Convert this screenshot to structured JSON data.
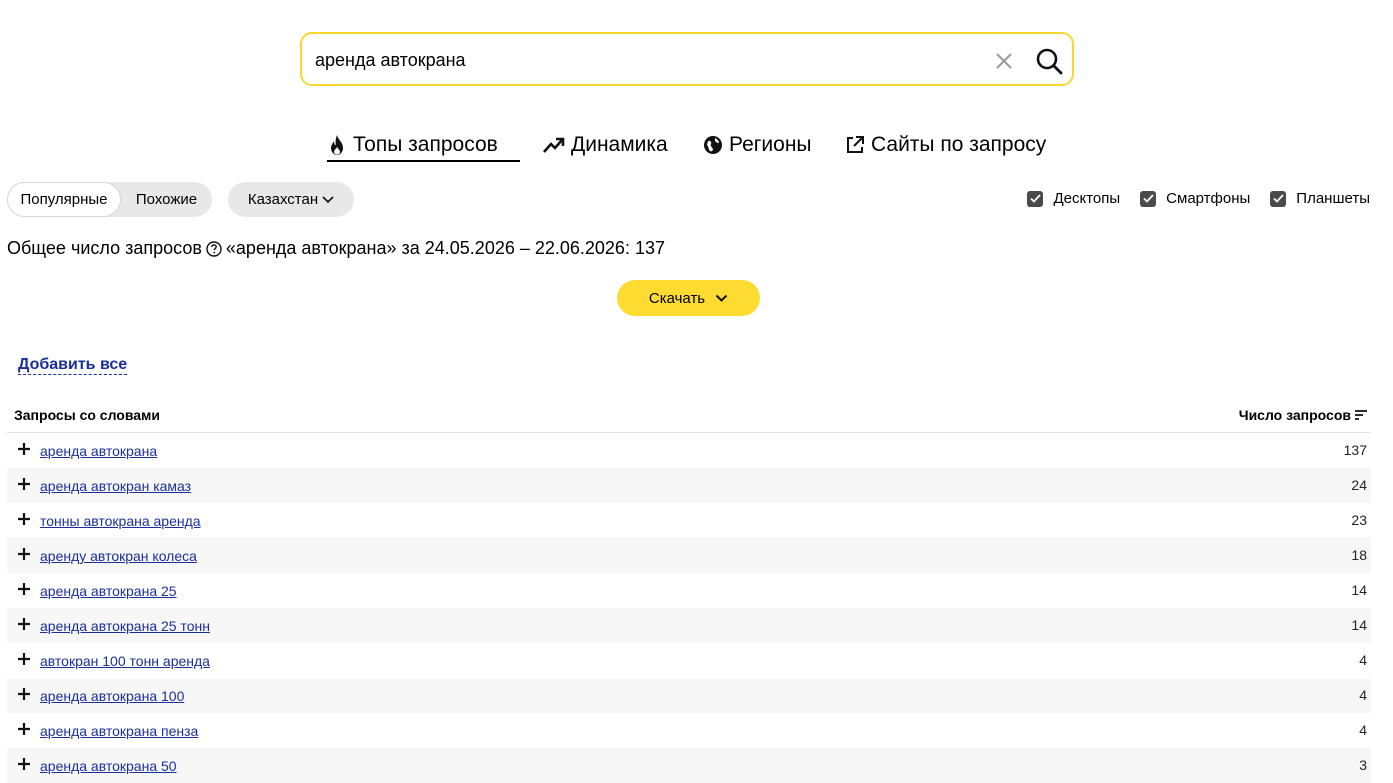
{
  "search": {
    "value": "аренда автокрана"
  },
  "tabs": [
    {
      "label": "Топы запросов",
      "icon": "fire-icon",
      "active": true
    },
    {
      "label": "Динамика",
      "icon": "trend-icon",
      "active": false
    },
    {
      "label": "Регионы",
      "icon": "globe-icon",
      "active": false
    },
    {
      "label": "Сайты по запросу",
      "icon": "external-link-icon",
      "active": false
    }
  ],
  "filters": {
    "popular": "Популярные",
    "similar": "Похожие",
    "region": "Казахстан",
    "devices": [
      {
        "label": "Десктопы",
        "checked": true
      },
      {
        "label": "Смартфоны",
        "checked": true
      },
      {
        "label": "Планшеты",
        "checked": true
      }
    ]
  },
  "summary": {
    "prefix": "Общее число запросов",
    "suffix": "«аренда автокрана» за 24.05.2026 – 22.06.2026: 137"
  },
  "download_label": "Скачать",
  "add_all_label": "Добавить все",
  "table": {
    "col_query": "Запросы со словами",
    "col_count": "Число запросов",
    "rows": [
      {
        "query": "аренда автокрана",
        "count": "137"
      },
      {
        "query": "аренда автокран камаз",
        "count": "24"
      },
      {
        "query": "тонны автокрана аренда",
        "count": "23"
      },
      {
        "query": "аренду автокран колеса",
        "count": "18"
      },
      {
        "query": "аренда автокрана 25",
        "count": "14"
      },
      {
        "query": "аренда автокрана 25 тонн",
        "count": "14"
      },
      {
        "query": "автокран 100 тонн аренда",
        "count": "4"
      },
      {
        "query": "аренда автокрана 100",
        "count": "4"
      },
      {
        "query": "аренда автокрана пенза",
        "count": "4"
      },
      {
        "query": "аренда автокрана 50",
        "count": "3"
      }
    ]
  },
  "colors": {
    "accent": "#fddb31",
    "link": "#1a2f9c",
    "search_border": "#f9d72f"
  }
}
